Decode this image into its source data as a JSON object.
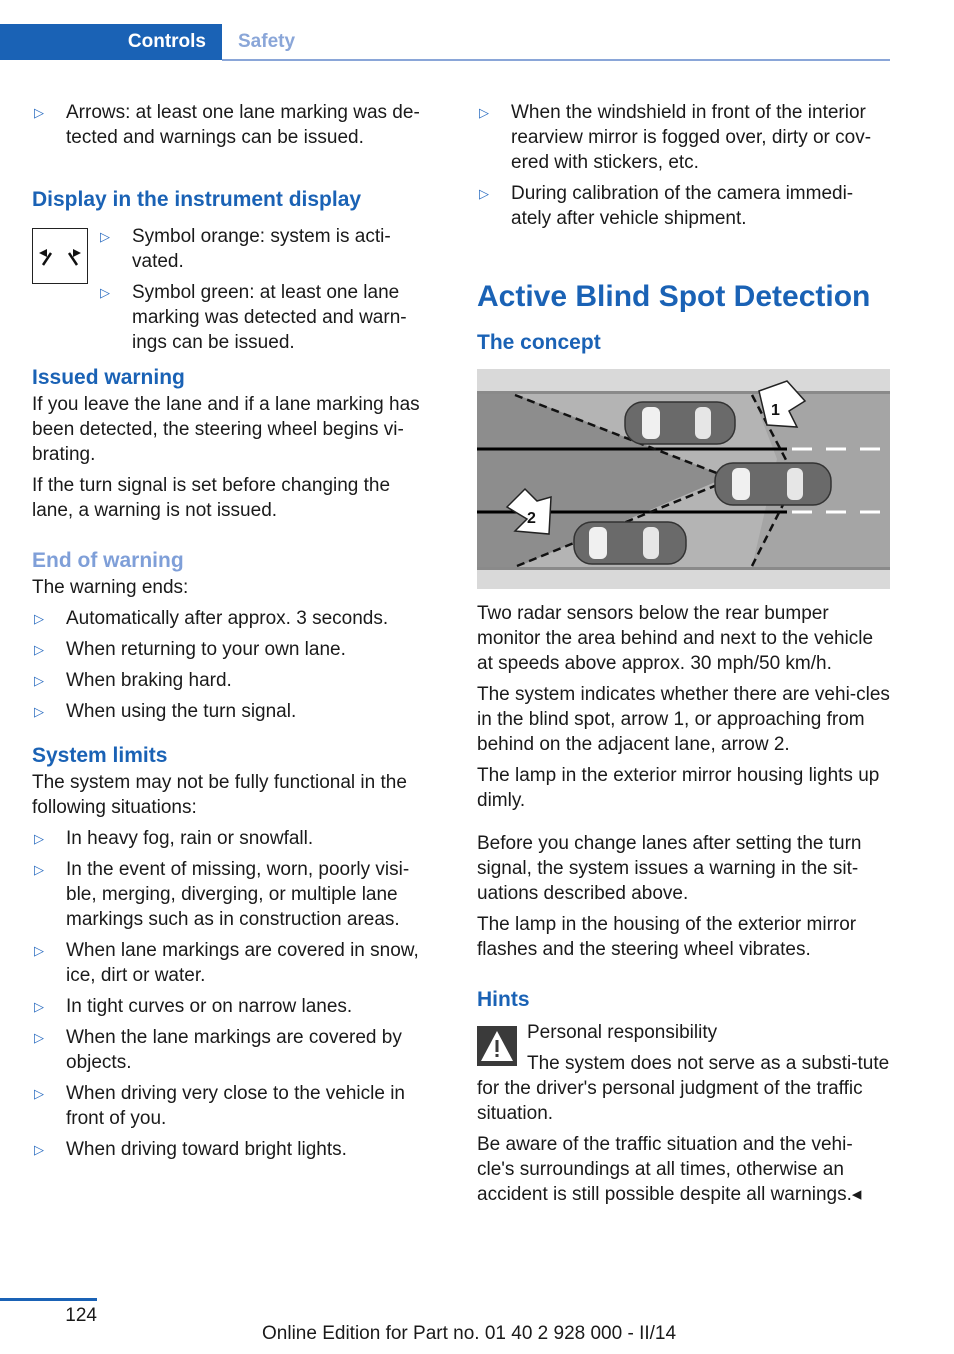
{
  "header": {
    "tabs": [
      {
        "label": "Controls",
        "active": true
      },
      {
        "label": "Safety",
        "active": false
      }
    ]
  },
  "left": {
    "intro_bullet": "Arrows: at least one lane marking was de-tected and warnings can be issued.",
    "display_section": {
      "heading": "Display in the instrument display",
      "icon": "lane-departure-icon",
      "bullets": [
        "Symbol orange: system is acti-vated.",
        "Symbol green: at least one lane marking was detected and warn-ings can be issued."
      ]
    },
    "issued_warning": {
      "heading": "Issued warning",
      "paragraphs": [
        "If you leave the lane and if a lane marking has been detected, the steering wheel begins vi-brating.",
        "If the turn signal is set before changing the lane, a warning is not issued."
      ]
    },
    "end_of_warning": {
      "heading": "End of warning",
      "intro": "The warning ends:",
      "bullets": [
        "Automatically after approx. 3 seconds.",
        "When returning to your own lane.",
        "When braking hard.",
        "When using the turn signal."
      ]
    },
    "system_limits": {
      "heading": "System limits",
      "intro": "The system may not be fully functional in the following situations:",
      "bullets": [
        "In heavy fog, rain or snowfall.",
        "In the event of missing, worn, poorly visi-ble, merging, diverging, or multiple lane markings such as in construction areas.",
        "When lane markings are covered in snow, ice, dirt or water.",
        "In tight curves or on narrow lanes.",
        "When the lane markings are covered by objects.",
        "When driving very close to the vehicle in front of you.",
        "When driving toward bright lights."
      ]
    }
  },
  "right": {
    "top_bullets": [
      "When the windshield in front of the interior rearview mirror is fogged over, dirty or cov-ered with stickers, etc.",
      "During calibration of the camera immedi-ately after vehicle shipment."
    ],
    "title": "Active Blind Spot Detection",
    "concept": {
      "heading": "The concept",
      "diagram": {
        "arrow_1_label": "1",
        "arrow_2_label": "2"
      },
      "paragraphs": [
        "Two radar sensors below the rear bumper monitor the area behind and next to the vehicle at speeds above approx. 30 mph/50 km/h.",
        "The system indicates whether there are vehi-cles in the blind spot, arrow 1, or approaching from behind on the adjacent lane, arrow 2.",
        "The lamp in the exterior mirror housing lights up dimly.",
        "Before you change lanes after setting the turn signal, the system issues a warning in the sit-uations described above.",
        "The lamp in the housing of the exterior mirror flashes and the steering wheel vibrates."
      ]
    },
    "hints": {
      "heading": "Hints",
      "warning_title": "Personal responsibility",
      "warning_text": "The system does not serve as a substi-tute for the driver's personal judgment of the traffic situation.",
      "closing": "Be aware of the traffic situation and the vehi-cle's surroundings at all times, otherwise an accident is still possible despite all warnings.◂"
    }
  },
  "footer": {
    "page_number": "124",
    "edition": "Online Edition for Part no. 01 40 2 928 000 - II/14"
  }
}
